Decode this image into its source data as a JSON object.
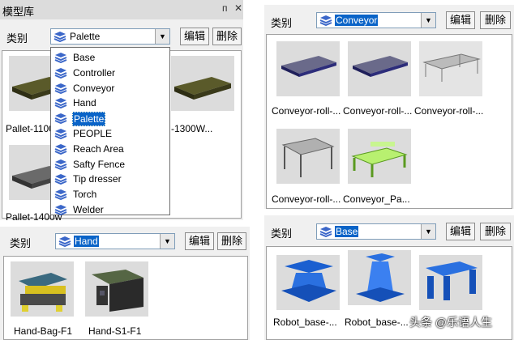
{
  "top_left": {
    "title": "模型库",
    "pin": "ᴨ",
    "close": "✕",
    "category_label": "类别",
    "category_value": "Palette",
    "edit_label": "编辑",
    "delete_label": "删除",
    "items": [
      {
        "caption": "Pallet-1100",
        "icon": "pallet-icon"
      },
      {
        "caption": "-1300W...",
        "icon": "pallet-icon"
      },
      {
        "caption": "Pallet-1400w",
        "icon": "pallet-icon"
      }
    ],
    "dropdown_options": [
      "Base",
      "Controller",
      "Conveyor",
      "Hand",
      "Palette",
      "PEOPLE",
      "Reach Area",
      "Safty Fence",
      "Tip dresser",
      "Torch",
      "Welder"
    ],
    "dropdown_selected": "Palette"
  },
  "top_right": {
    "category_label": "类别",
    "category_value": "Conveyor",
    "edit_label": "编辑",
    "delete_label": "删除",
    "items": [
      {
        "caption": "Conveyor-roll-...",
        "icon": "roller-conveyor-icon"
      },
      {
        "caption": "Conveyor-roll-...",
        "icon": "roller-conveyor-icon"
      },
      {
        "caption": "Conveyor-roll-...",
        "icon": "frame-conveyor-icon"
      },
      {
        "caption": "Conveyor-roll-...",
        "icon": "roller-conveyor-icon"
      },
      {
        "caption": "Conveyor_Pa...",
        "icon": "pallet-conveyor-icon"
      }
    ]
  },
  "bottom_left": {
    "category_label": "类别",
    "category_value": "Hand",
    "edit_label": "编辑",
    "delete_label": "删除",
    "items": [
      {
        "caption": "Hand-Bag-F1",
        "icon": "gripper-icon"
      },
      {
        "caption": "Hand-S1-F1",
        "icon": "gripper-icon"
      }
    ]
  },
  "bottom_right": {
    "category_label": "类别",
    "category_value": "Base",
    "edit_label": "编辑",
    "delete_label": "删除",
    "items": [
      {
        "caption": "Robot_base-...",
        "icon": "robot-base-icon"
      },
      {
        "caption": "Robot_base-...",
        "icon": "robot-base-icon"
      },
      {
        "caption": "",
        "icon": "robot-base-icon"
      }
    ]
  },
  "watermark": "头条 @乐语人生",
  "colors": {
    "selection": "#0a64c8",
    "panel": "#f0f0f0",
    "thumb_bg": "#dcdcdc"
  }
}
